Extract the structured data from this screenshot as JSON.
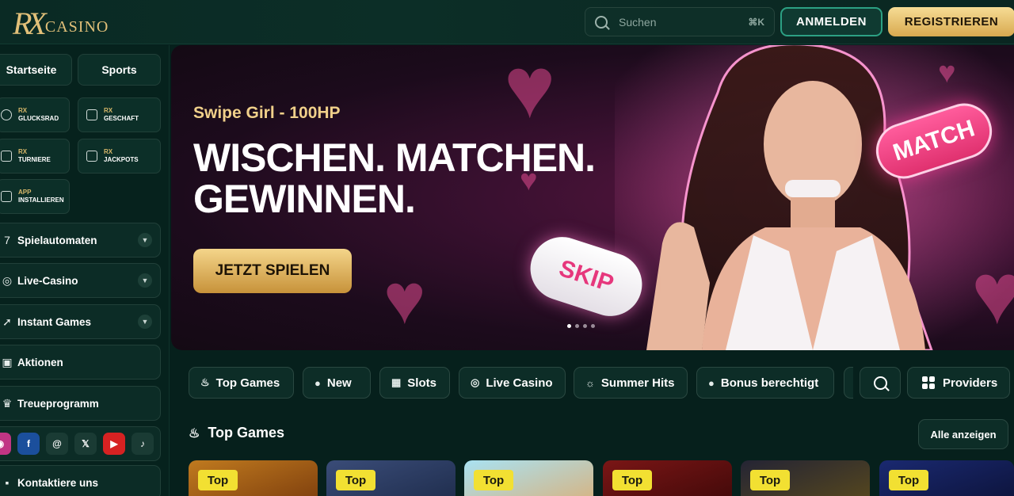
{
  "header": {
    "logo_rx": "RX",
    "logo_text": "CASINO",
    "search_placeholder": "Suchen",
    "search_shortcut": "⌘K",
    "login_label": "ANMELDEN",
    "register_label": "REGISTRIEREN"
  },
  "sidebar": {
    "top_buttons": [
      "Startseite",
      "Sports"
    ],
    "tiles": [
      {
        "pre": "RX",
        "main": "GLUCKSRAD",
        "icon": "wheel-icon"
      },
      {
        "pre": "RX",
        "main": "GESCHAFT",
        "icon": "shop-bag-icon"
      },
      {
        "pre": "RX",
        "main": "TURNIERE",
        "icon": "trophy-icon"
      },
      {
        "pre": "RX",
        "main": "JACKPOTS",
        "icon": "jackpot-icon"
      },
      {
        "pre": "APP",
        "main": "INSTALLIEREN",
        "icon": "phone-icon"
      }
    ],
    "menu": [
      {
        "label": "Spielautomaten",
        "icon": "seven-icon",
        "expandable": true
      },
      {
        "label": "Live-Casino",
        "icon": "chip-icon",
        "expandable": true
      },
      {
        "label": "Instant Games",
        "icon": "rocket-icon",
        "expandable": true
      },
      {
        "label": "Aktionen",
        "icon": "gift-icon",
        "expandable": false
      },
      {
        "label": "Treueprogramm",
        "icon": "crown-icon",
        "expandable": false
      }
    ],
    "socials": [
      "instagram-icon",
      "facebook-icon",
      "threads-icon",
      "x-icon",
      "youtube-icon",
      "tiktok-icon"
    ],
    "contact_label": "Kontaktiere uns"
  },
  "hero": {
    "subtitle": "Swipe Girl - 100HP",
    "title_line1": "WISCHEN. MATCHEN.",
    "title_line2": "GEWINNEN.",
    "cta_label": "JETZT SPIELEN",
    "skip_label": "SKIP",
    "match_label": "MATCH",
    "slides_count": 4,
    "active_slide": 1
  },
  "categories": [
    {
      "label": "Top Games",
      "icon": "flame-icon"
    },
    {
      "label": "New",
      "icon": "new-icon"
    },
    {
      "label": "Slots",
      "icon": "slot-icon"
    },
    {
      "label": "Live Casino",
      "icon": "chip-icon"
    },
    {
      "label": "Summer Hits",
      "icon": "sun-icon"
    },
    {
      "label": "Bonus berechtigt",
      "icon": "bonus-icon"
    }
  ],
  "providers_label": "Providers",
  "section": {
    "title": "Top Games",
    "see_all_label": "Alle anzeigen"
  },
  "game_cards": [
    {
      "badge": "Top",
      "color": "#b5651d"
    },
    {
      "badge": "Top",
      "color": "#2b3f6a"
    },
    {
      "badge": "Top",
      "color": "#8fd0e8"
    },
    {
      "badge": "Top",
      "color": "#6a1212"
    },
    {
      "badge": "Top",
      "color": "#1c1c2a"
    },
    {
      "badge": "Top",
      "color": "#17235e"
    }
  ],
  "colors": {
    "accent_gold": "#e2c079",
    "accent_green": "#2ca083",
    "badge_yellow": "#f2e032",
    "background": "#06201c"
  }
}
